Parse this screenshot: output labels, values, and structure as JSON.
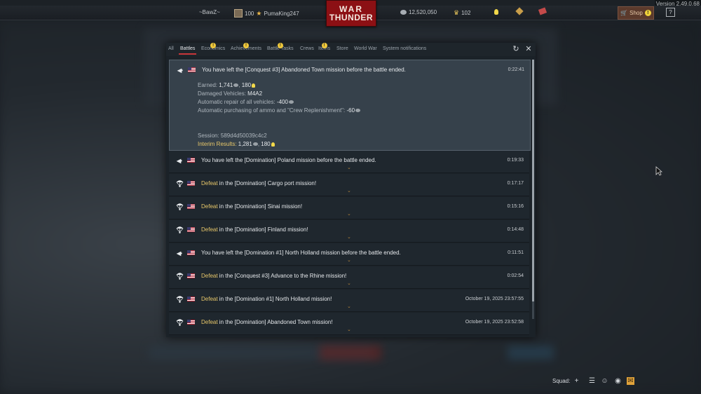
{
  "version": "Version 2.49.0.68",
  "topbar": {
    "nickname": "~BawZ~",
    "level": "100",
    "squadron_name": "PumaKing247",
    "silver_lions": "12,520,050",
    "golden_eagles": "102",
    "shop_label": "Shop",
    "shop_badge": "!",
    "help_label": "?"
  },
  "logo": {
    "line1": "WAR",
    "line2": "THUNDER"
  },
  "tabs": [
    {
      "label": "All",
      "badge": ""
    },
    {
      "label": "Battles",
      "badge": ""
    },
    {
      "label": "Economics",
      "badge": "!"
    },
    {
      "label": "Achievements",
      "badge": "!"
    },
    {
      "label": "Battle Tasks",
      "badge": "!"
    },
    {
      "label": "Crews",
      "badge": ""
    },
    {
      "label": "Items",
      "badge": "!"
    },
    {
      "label": "Store",
      "badge": ""
    },
    {
      "label": "World War",
      "badge": ""
    },
    {
      "label": "System notifications",
      "badge": ""
    }
  ],
  "messages": [
    {
      "icon": "leave-arrow",
      "prefix": "",
      "text": "You have left the [Conquest #3] Abandoned Town mission before the battle ended.",
      "time": "0:22:41",
      "expanded": true,
      "details": {
        "earned_label": "Earned: ",
        "earned_sl": "1,741",
        "earned_rp": "180",
        "damaged_label": "Damaged Vehicles: ",
        "damaged_value": "M4A2",
        "repair_label": "Automatic repair of all vehicles: ",
        "repair_value": "-400",
        "ammo_label": "Automatic purchasing of ammo and \"Crew Replenishment\": ",
        "ammo_value": "-60",
        "session_label": "Session: ",
        "session_value": "589d4d50039c4c2",
        "interim_label": "Interim Results: ",
        "interim_sl": "1,281",
        "interim_rp": "180"
      }
    },
    {
      "icon": "leave-arrow",
      "prefix": "",
      "text": "You have left the [Domination] Poland mission before the battle ended.",
      "time": "0:19:33",
      "expanded": false
    },
    {
      "icon": "parachute",
      "prefix": "Defeat",
      "text": " in the [Domination] Cargo port mission!",
      "time": "0:17:17",
      "expanded": false
    },
    {
      "icon": "parachute",
      "prefix": "Defeat",
      "text": " in the [Domination] Sinai mission!",
      "time": "0:15:16",
      "expanded": false
    },
    {
      "icon": "parachute",
      "prefix": "Defeat",
      "text": " in the [Domination] Finland mission!",
      "time": "0:14:48",
      "expanded": false
    },
    {
      "icon": "leave-arrow",
      "prefix": "",
      "text": "You have left the [Domination #1] North Holland mission before the battle ended.",
      "time": "0:11:51",
      "expanded": false
    },
    {
      "icon": "parachute",
      "prefix": "Defeat",
      "text": " in the [Conquest #3] Advance to the Rhine mission!",
      "time": "0:02:54",
      "expanded": false
    },
    {
      "icon": "parachute",
      "prefix": "Defeat",
      "text": " in the [Domination #1] North Holland mission!",
      "time": "October 19, 2025 23:57:55",
      "expanded": false
    },
    {
      "icon": "parachute",
      "prefix": "Defeat",
      "text": " in the [Domination] Abandoned Town mission!",
      "time": "October 19, 2025 23:52:58",
      "expanded": false
    }
  ],
  "bottom": {
    "squad_label": "Squad:"
  },
  "colors": {
    "accent_red": "#c7363a",
    "defeat_gold": "#e8c86a",
    "badge_yellow": "#efc83b"
  }
}
